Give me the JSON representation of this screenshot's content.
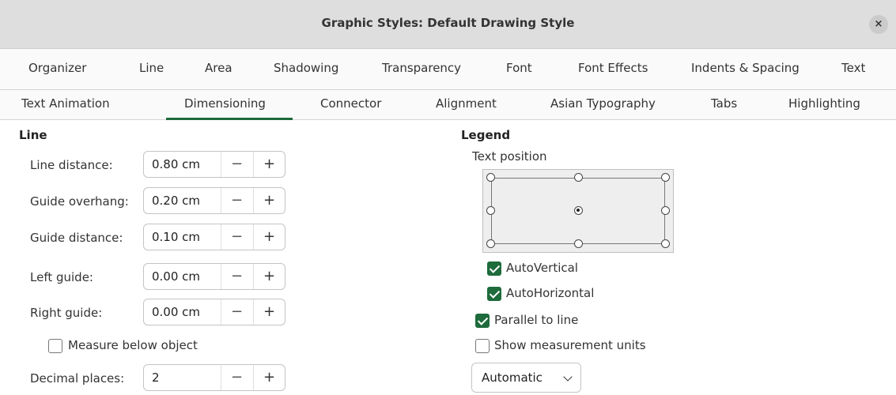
{
  "window": {
    "title": "Graphic Styles: Default Drawing Style",
    "close_symbol": "×"
  },
  "tabs_row1": [
    "Organizer",
    "Line",
    "Area",
    "Shadowing",
    "Transparency",
    "Font",
    "Font Effects",
    "Indents & Spacing",
    "Text"
  ],
  "tabs_row2": [
    "Text Animation",
    "Dimensioning",
    "Connector",
    "Alignment",
    "Asian Typography",
    "Tabs",
    "Highlighting"
  ],
  "active_tab": "Dimensioning",
  "line_section": {
    "title": "Line",
    "fields": [
      {
        "label": "Line distance:",
        "value": "0.80 cm"
      },
      {
        "label": "Guide overhang:",
        "value": "0.20 cm"
      },
      {
        "label": "Guide distance:",
        "value": "0.10 cm"
      },
      {
        "label": "Left guide:",
        "value": "0.00 cm"
      },
      {
        "label": "Right guide:",
        "value": "0.00 cm"
      }
    ],
    "measure_below": {
      "label": "Measure below object",
      "checked": false
    },
    "decimal_places": {
      "label": "Decimal places:",
      "value": "2"
    },
    "minus_symbol": "−",
    "plus_symbol": "+"
  },
  "legend_section": {
    "title": "Legend",
    "text_position_label": "Text position",
    "auto_vertical": {
      "label": "AutoVertical",
      "checked": true
    },
    "auto_horizontal": {
      "label": "AutoHorizontal",
      "checked": true
    },
    "parallel_to_line": {
      "label": "Parallel to line",
      "checked": true
    },
    "show_units": {
      "label": "Show measurement units",
      "checked": false
    },
    "units_dropdown": {
      "value": "Automatic"
    }
  },
  "colors": {
    "accent": "#1e6b3c",
    "titlebar": "#dedede"
  }
}
